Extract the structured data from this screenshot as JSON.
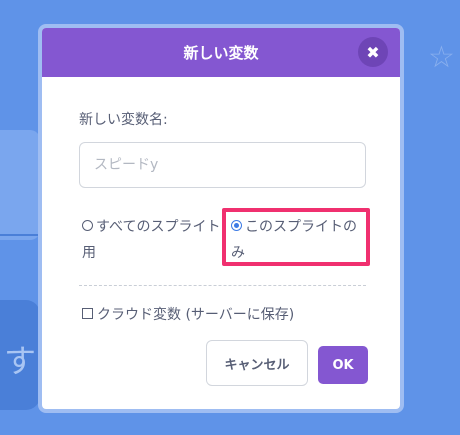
{
  "dialog": {
    "title": "新しい変数",
    "close_icon": "close-icon"
  },
  "form": {
    "name_label": "新しい変数名:",
    "name_placeholder": "スピードy",
    "name_value": ""
  },
  "scope_options": [
    {
      "label": "すべてのスプライト用",
      "selected": false
    },
    {
      "label": "このスプライトのみ",
      "selected": true
    }
  ],
  "cloud_option": {
    "label": "クラウド変数 (サーバーに保存)",
    "checked": false
  },
  "buttons": {
    "cancel": "キャンセル",
    "ok": "OK"
  },
  "colors": {
    "header": "#8457d1",
    "highlight": "#f0306f",
    "background": "#5f93e8"
  },
  "background": {
    "glyph": "す",
    "star_icon": "star-icon"
  }
}
